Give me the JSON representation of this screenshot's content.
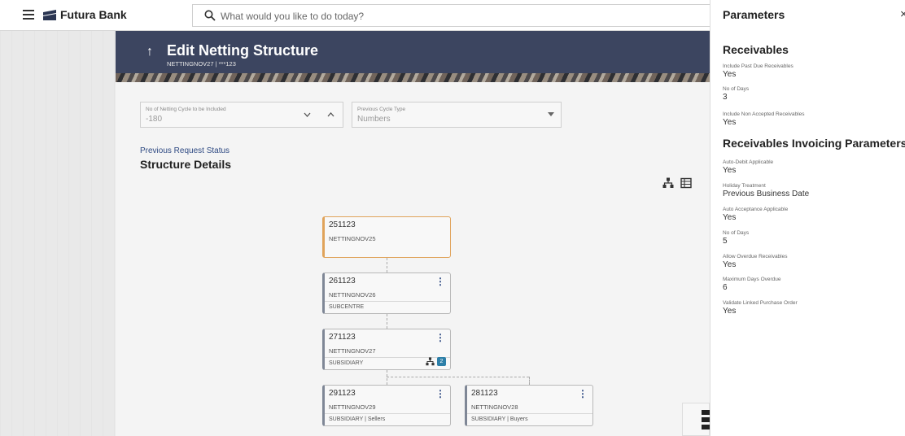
{
  "brand": "Futura Bank",
  "search": {
    "placeholder": "What would you like to do today?"
  },
  "page": {
    "title": "Edit Netting Structure",
    "subtitle": "NETTINGNOV27 | ***123"
  },
  "filters": [
    {
      "label": "No of Netting Cycle to be Included",
      "value": "-180"
    },
    {
      "label": "Previous Cycle Type",
      "value": "Numbers"
    }
  ],
  "prev_request_link": "Previous Request Status",
  "section_title": "Structure Details",
  "tree": {
    "root": {
      "code": "251123",
      "name": "NETTINGNOV25"
    },
    "n1": {
      "code": "261123",
      "name": "NETTINGNOV26",
      "type": "SUBCENTRE"
    },
    "n2": {
      "code": "271123",
      "name": "NETTINGNOV27",
      "type": "SUBSIDIARY",
      "badge": "2"
    },
    "n3": {
      "code": "291123",
      "name": "NETTINGNOV29",
      "type": "SUBSIDIARY | Sellers"
    },
    "n4": {
      "code": "281123",
      "name": "NETTINGNOV28",
      "type": "SUBSIDIARY | Buyers"
    }
  },
  "panel": {
    "title": "Parameters",
    "close": "×",
    "receivables_heading": "Receivables",
    "receivables": [
      {
        "label": "Include Past Due Receivables",
        "value": "Yes"
      },
      {
        "label": "No of Days",
        "value": "3"
      },
      {
        "label": "Include Non Accepted Receivables",
        "value": "Yes"
      }
    ],
    "invoicing_heading": "Receivables Invoicing Parameters",
    "invoicing": [
      {
        "label": "Auto-Debit Applicable",
        "value": "Yes"
      },
      {
        "label": "Holiday Treatment",
        "value": "Previous Business Date"
      },
      {
        "label": "Auto Acceptance Applicable",
        "value": "Yes"
      },
      {
        "label": "No of Days",
        "value": "5"
      },
      {
        "label": "Allow Overdue Receivables",
        "value": "Yes"
      },
      {
        "label": "Maximum Days Overdue",
        "value": "6"
      },
      {
        "label": "Validate Linked Purchase Order",
        "value": "Yes"
      }
    ]
  },
  "colors": {
    "header_band": "#3c4560",
    "accent_link": "#2f4a83",
    "root_accent": "#e08a1e",
    "badge": "#2d7fa8"
  }
}
